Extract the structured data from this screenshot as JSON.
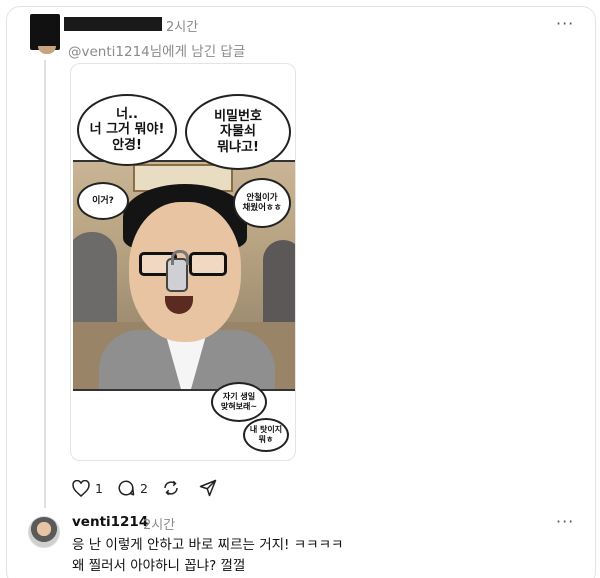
{
  "post": {
    "time": "2시간",
    "reply_to": "@venti1214님에게 남긴 답글",
    "more": "···",
    "comic": {
      "bubble1": "너..\n너 그거 뭐야!\n안경!",
      "bubble2": "비밀번호\n자물쇠\n뭐냐고!",
      "bubble3": "이거?",
      "bubble4": "안철이가\n채웠어ㅎㅎ",
      "bubble5": "자기 생일\n맞혀보래~",
      "bubble6": "내 탓이지\n뭐ㅎ"
    },
    "actions": {
      "likes": "1",
      "comments": "2"
    }
  },
  "reply": {
    "username": "venti1214",
    "time": "2시간",
    "more": "···",
    "text": "응 난 이렇게 안하고 바로 찌르는 거지! ㅋㅋㅋㅋ\n왜 찔러서 아야하니 꼽냐? 껄껄"
  }
}
